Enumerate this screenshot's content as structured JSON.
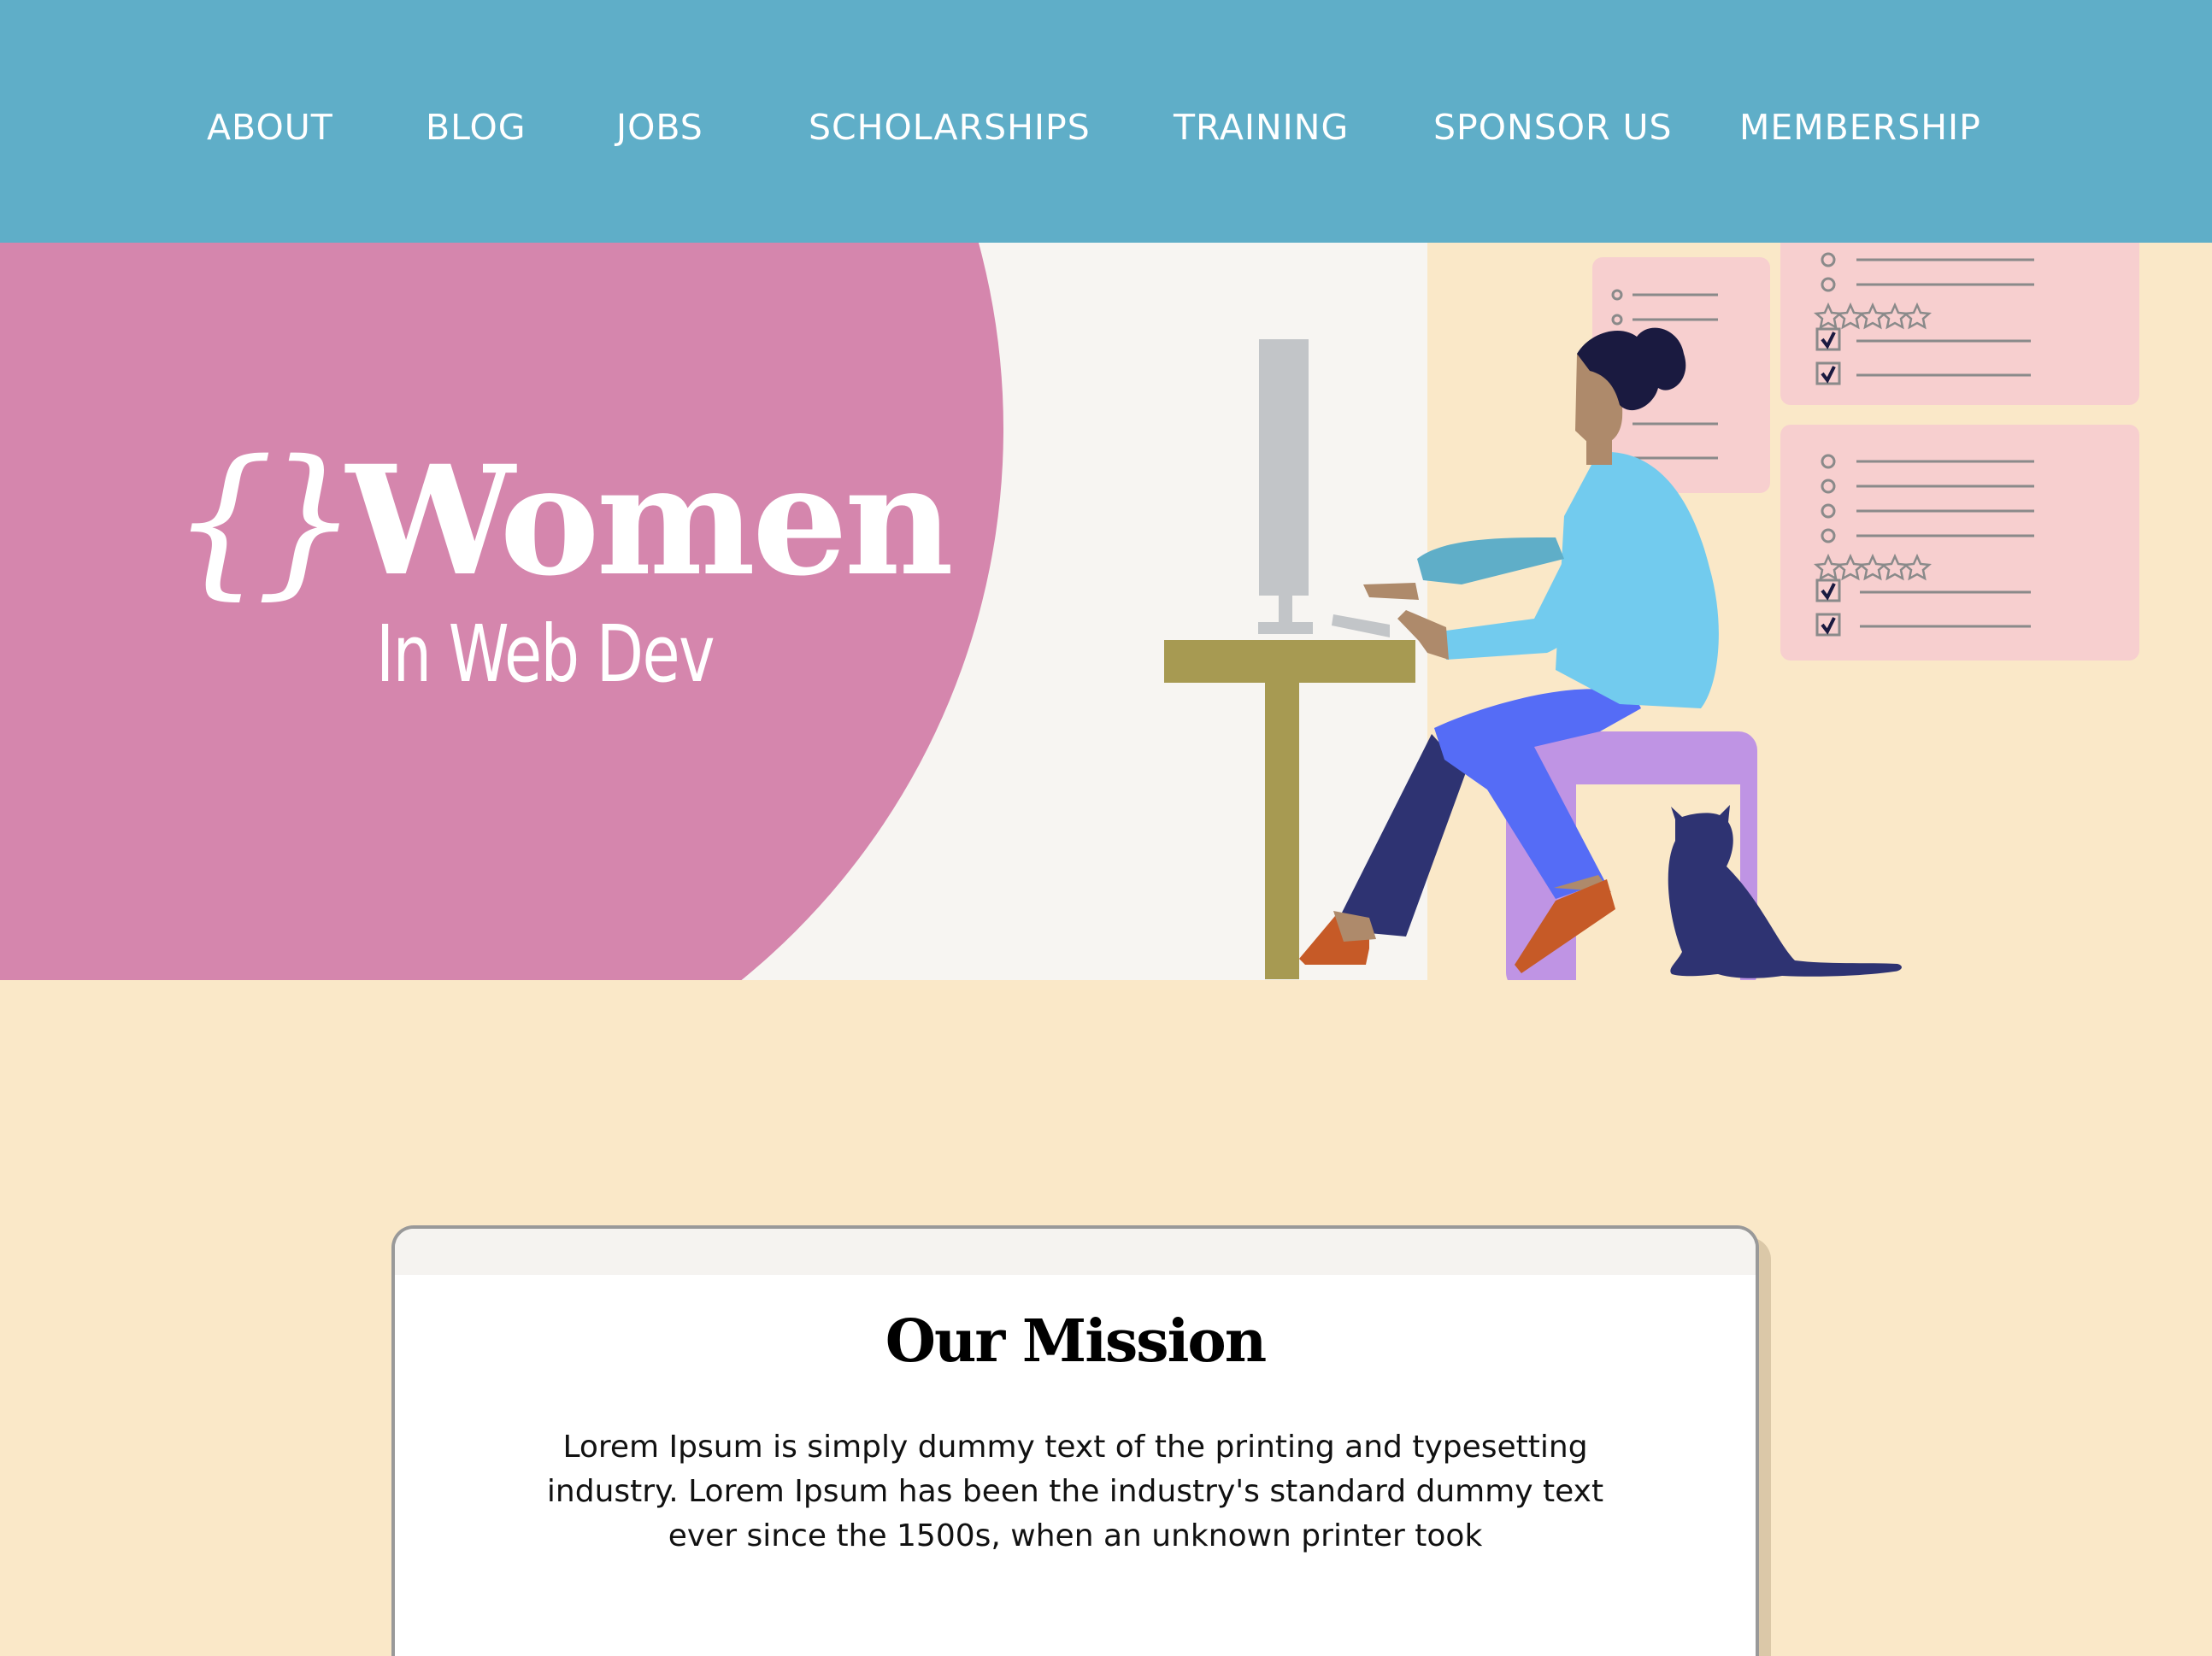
{
  "nav": {
    "items": [
      {
        "label": "ABOUT"
      },
      {
        "label": "BLOG"
      },
      {
        "label": "JOBS"
      },
      {
        "label": "SCHOLARSHIPS"
      },
      {
        "label": "TRAINING"
      },
      {
        "label": "SPONSOR US"
      },
      {
        "label": "MEMBERSHIP"
      }
    ]
  },
  "hero": {
    "logo_braces": "{}",
    "logo_title": "Women",
    "logo_subtitle": "In Web Dev"
  },
  "mission": {
    "title": "Our Mission",
    "text": "Lorem Ipsum is simply dummy text of the printing and typesetting industry. Lorem Ipsum has been the industry's standard dummy text ever since the 1500s, when an unknown printer took"
  },
  "colors": {
    "nav_bg": "#5faec8",
    "hero_circle": "#d586ad",
    "page_bg": "#fae8c8",
    "hero_light": "#f7f5f2"
  }
}
